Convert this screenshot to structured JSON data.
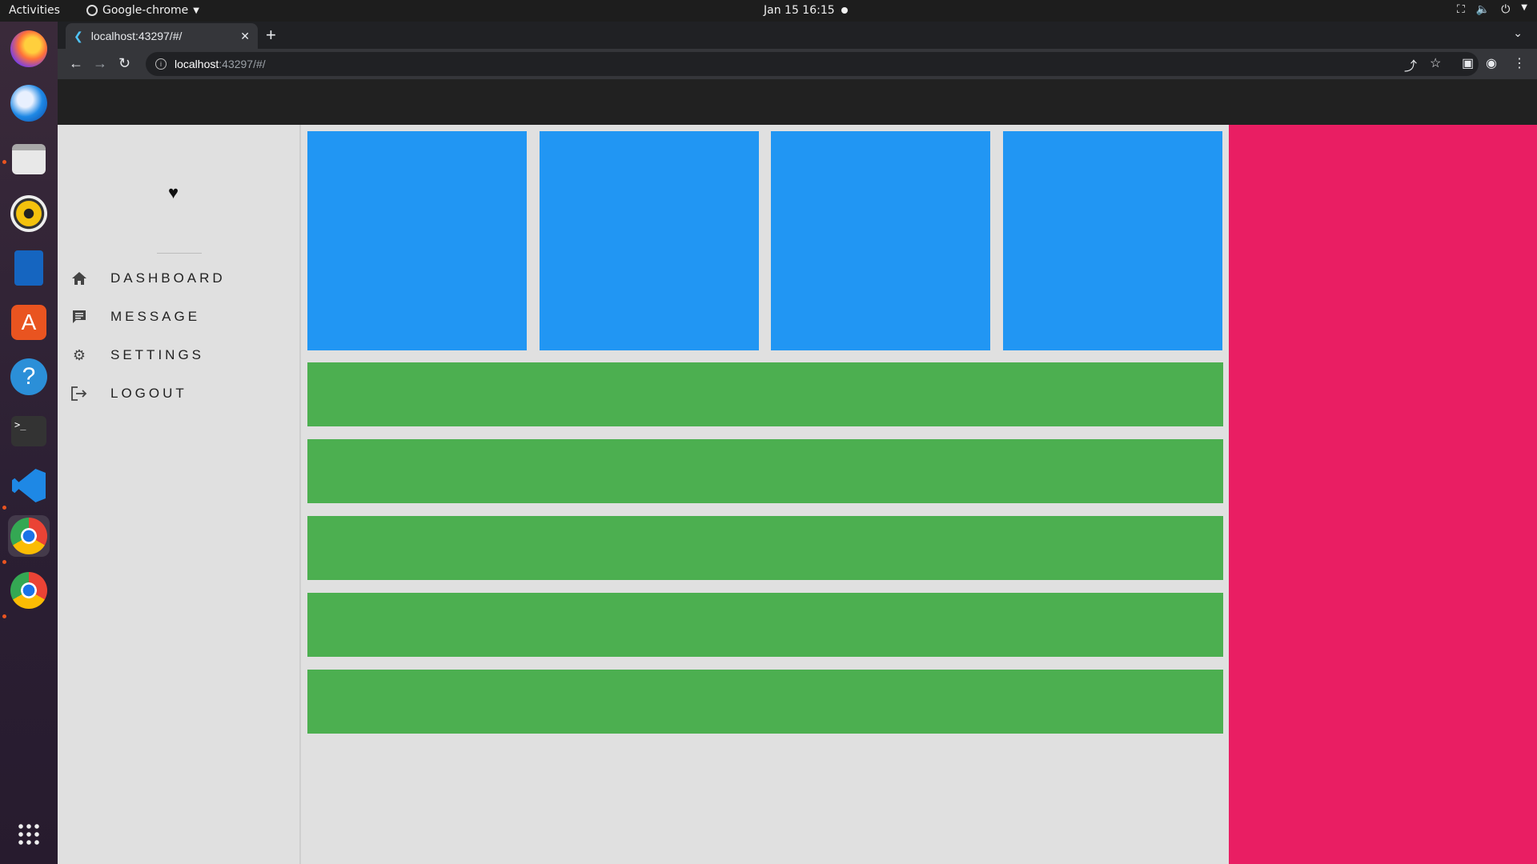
{
  "system": {
    "activities": "Activities",
    "app_name": "Google-chrome",
    "clock": "Jan 15  16:15"
  },
  "browser": {
    "tab_title": "localhost:43297/#/",
    "url_host": "localhost",
    "url_path": ":43297/#/"
  },
  "app": {
    "nav": [
      {
        "label": "DASHBOARD",
        "icon": "home-icon"
      },
      {
        "label": "MESSAGE",
        "icon": "message-icon"
      },
      {
        "label": "SETTINGS",
        "icon": "gear-icon"
      },
      {
        "label": "LOGOUT",
        "icon": "logout-icon"
      }
    ],
    "logo_icon": "heart-icon",
    "colors": {
      "appbar": "#212121",
      "tiles": "#2196f3",
      "rows": "#4caf50",
      "right_panel": "#e91e63"
    }
  },
  "dock": {
    "apps": [
      "firefox",
      "thunderbird",
      "files",
      "rhythmbox",
      "writer",
      "software",
      "help",
      "terminal",
      "vscode",
      "chrome",
      "chrome"
    ]
  }
}
